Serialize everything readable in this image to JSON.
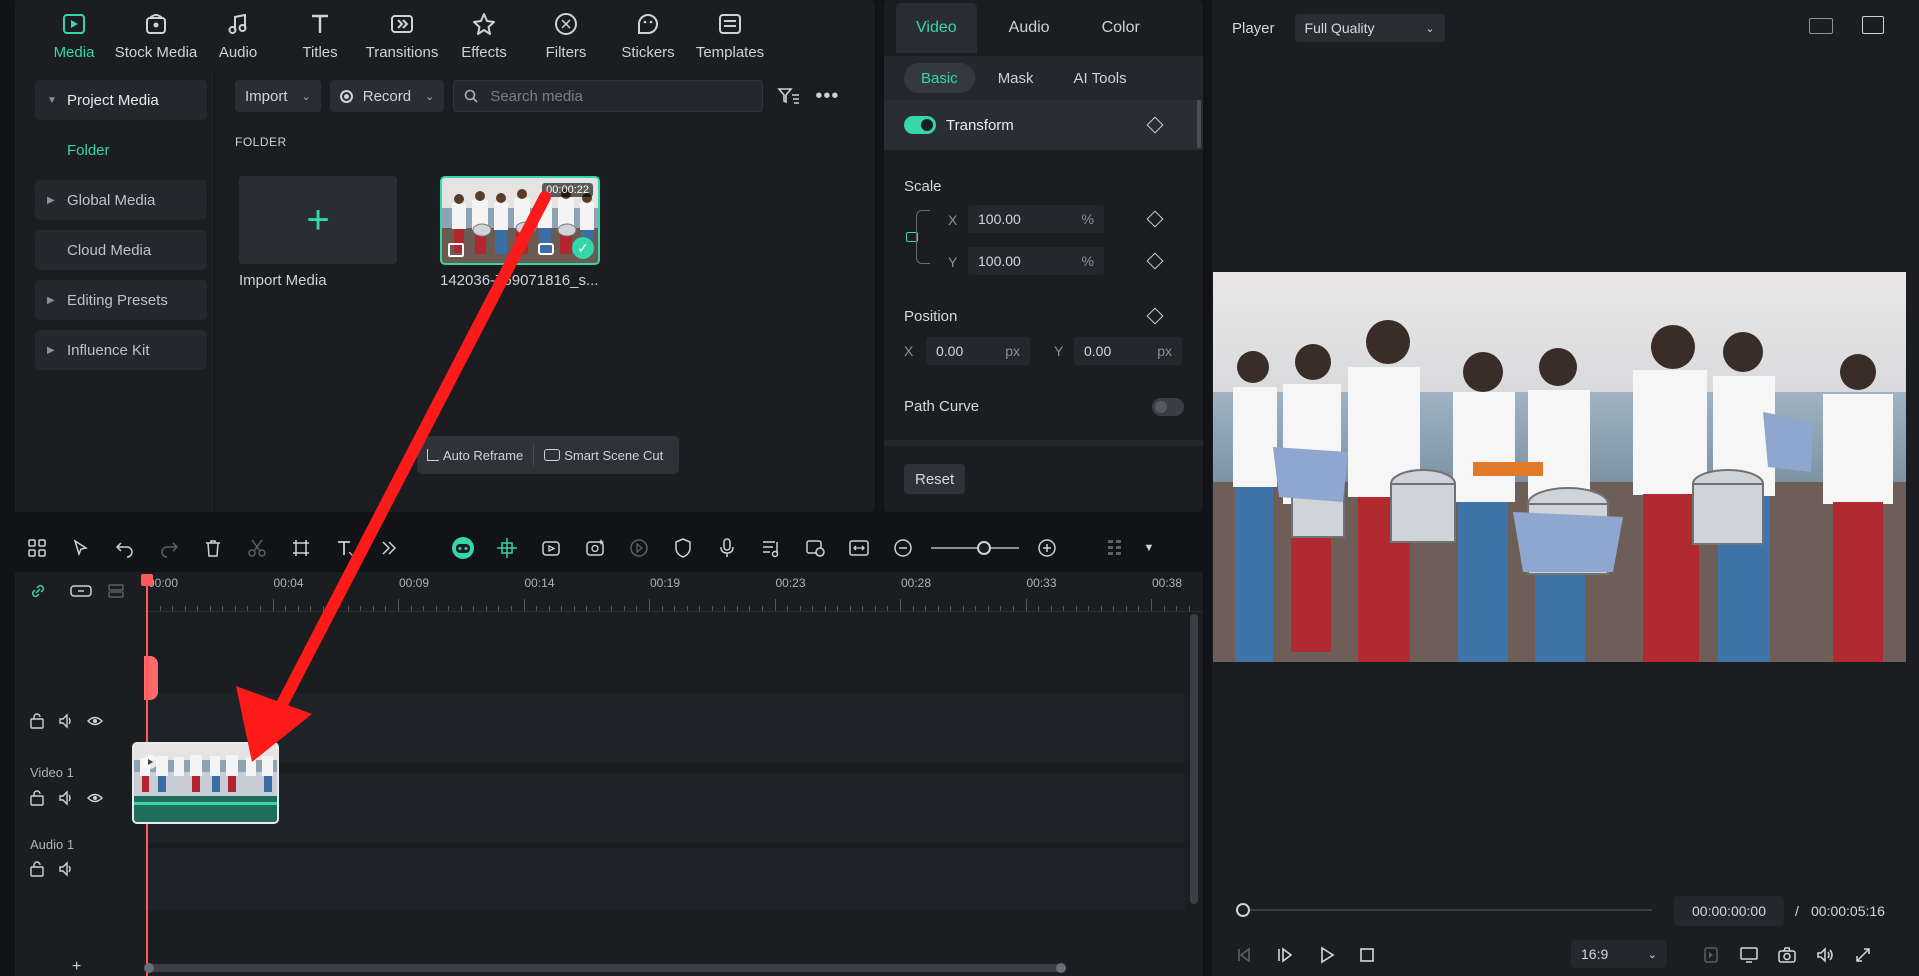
{
  "top_tabs": [
    {
      "label": "Media",
      "icon": "media-icon",
      "active": true
    },
    {
      "label": "Stock Media",
      "icon": "stock-media-icon"
    },
    {
      "label": "Audio",
      "icon": "music-note-icon"
    },
    {
      "label": "Titles",
      "icon": "titles-icon"
    },
    {
      "label": "Transitions",
      "icon": "transitions-icon"
    },
    {
      "label": "Effects",
      "icon": "effects-icon"
    },
    {
      "label": "Filters",
      "icon": "filters-icon"
    },
    {
      "label": "Stickers",
      "icon": "stickers-icon"
    },
    {
      "label": "Templates",
      "icon": "templates-icon"
    }
  ],
  "sidebar": {
    "items": [
      {
        "label": "Project Media"
      },
      {
        "label": "Folder"
      },
      {
        "label": "Global Media"
      },
      {
        "label": "Cloud Media"
      },
      {
        "label": "Editing Presets"
      },
      {
        "label": "Influence Kit"
      }
    ]
  },
  "media_toolbar": {
    "import_label": "Import",
    "record_label": "Record",
    "search_placeholder": "Search media"
  },
  "media": {
    "folder_label": "FOLDER",
    "import_caption": "Import Media",
    "clip_name": "142036-769071816_s...",
    "clip_duration": "00:00:22"
  },
  "float_bar": {
    "auto_reframe": "Auto Reframe",
    "smart_scene_cut": "Smart Scene Cut"
  },
  "properties": {
    "tabs": [
      "Video",
      "Audio",
      "Color"
    ],
    "sub_tabs": [
      "Basic",
      "Mask",
      "AI Tools"
    ],
    "transform_label": "Transform",
    "scale_label": "Scale",
    "scale_x": "100.00",
    "scale_y": "100.00",
    "percent": "%",
    "position_label": "Position",
    "pos_x": "0.00",
    "pos_y": "0.00",
    "px": "px",
    "x_axis": "X",
    "y_axis": "Y",
    "path_curve_label": "Path Curve",
    "reset_label": "Reset"
  },
  "player": {
    "label": "Player",
    "quality": "Full Quality",
    "current_time": "00:00:00:00",
    "separator": "/",
    "total_time": "00:00:05:16",
    "aspect_ratio": "16:9",
    "progress": 0
  },
  "timeline": {
    "ruler_labels": [
      "00:00",
      "00:04",
      "00:09",
      "00:14",
      "00:19",
      "00:23",
      "00:28",
      "00:33",
      "00:38"
    ],
    "tracks": [
      {
        "name": ""
      },
      {
        "name": "Video 1"
      },
      {
        "name": "Audio 1"
      }
    ],
    "zoom_level": 0.6
  },
  "colors": {
    "accent": "#35d6a9",
    "playhead": "#ff5a5f",
    "annotation_arrow": "#ff1a1a"
  }
}
